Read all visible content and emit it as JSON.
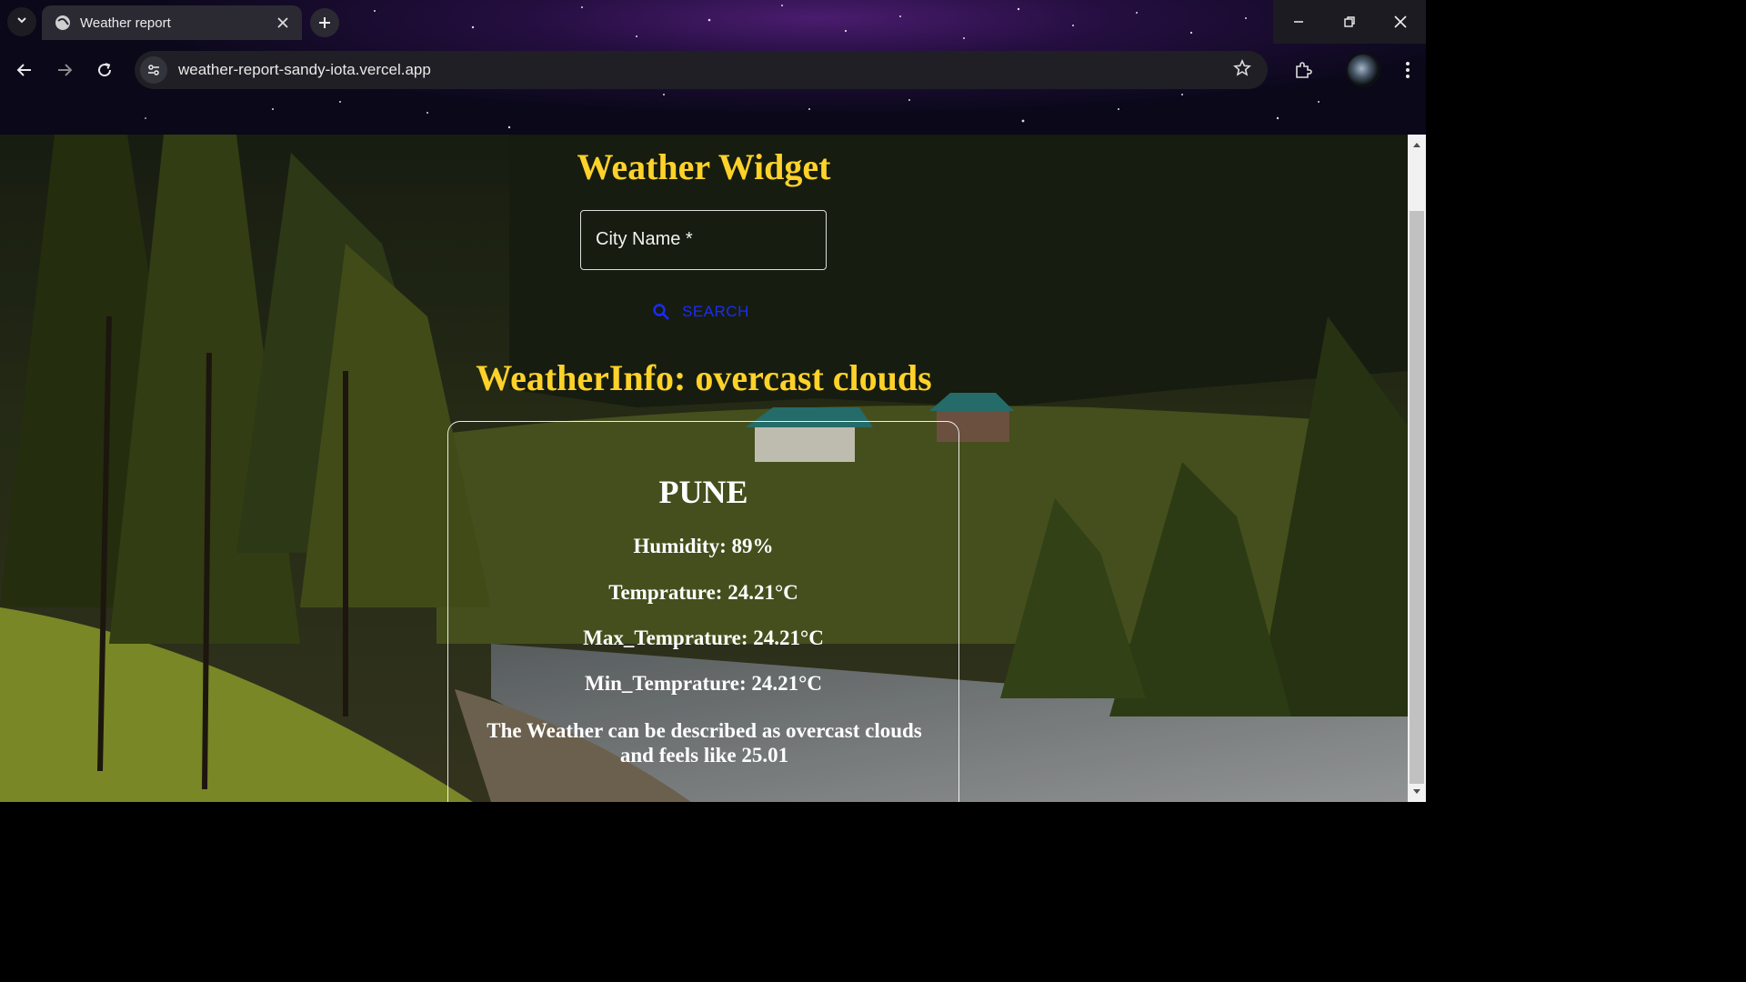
{
  "browser": {
    "tab_title": "Weather report",
    "url": "weather-report-sandy-iota.vercel.app",
    "icons": {
      "tab_menu": "chevron-down-icon",
      "favicon": "globe-icon",
      "tab_close": "close-icon",
      "new_tab": "plus-icon",
      "back": "arrow-left-icon",
      "forward": "arrow-right-icon",
      "reload": "reload-icon",
      "site_info": "site-settings-icon",
      "bookmark": "star-icon",
      "extensions": "puzzle-icon",
      "profile": "avatar",
      "menu": "kebab-menu-icon",
      "minimize": "minimize-icon",
      "restore": "restore-icon",
      "close_window": "close-icon"
    }
  },
  "page": {
    "title": "Weather Widget",
    "city_input": {
      "label": "City Name *",
      "value": ""
    },
    "search_button": {
      "label": "SEARCH",
      "icon": "search-icon"
    },
    "info_heading": "WeatherInfo: overcast clouds",
    "card": {
      "city": "PUNE",
      "humidity": "Humidity: 89%",
      "temperature": "Temprature: 24.21°C",
      "max_temperature": "Max_Temprature: 24.21°C",
      "min_temperature": "Min_Temprature: 24.21°C",
      "description": "The Weather can be described as overcast clouds and feels like 25.01"
    }
  },
  "colors": {
    "heading": "#ffd22a",
    "search": "#1a2bff",
    "card_text": "#ffffff"
  }
}
